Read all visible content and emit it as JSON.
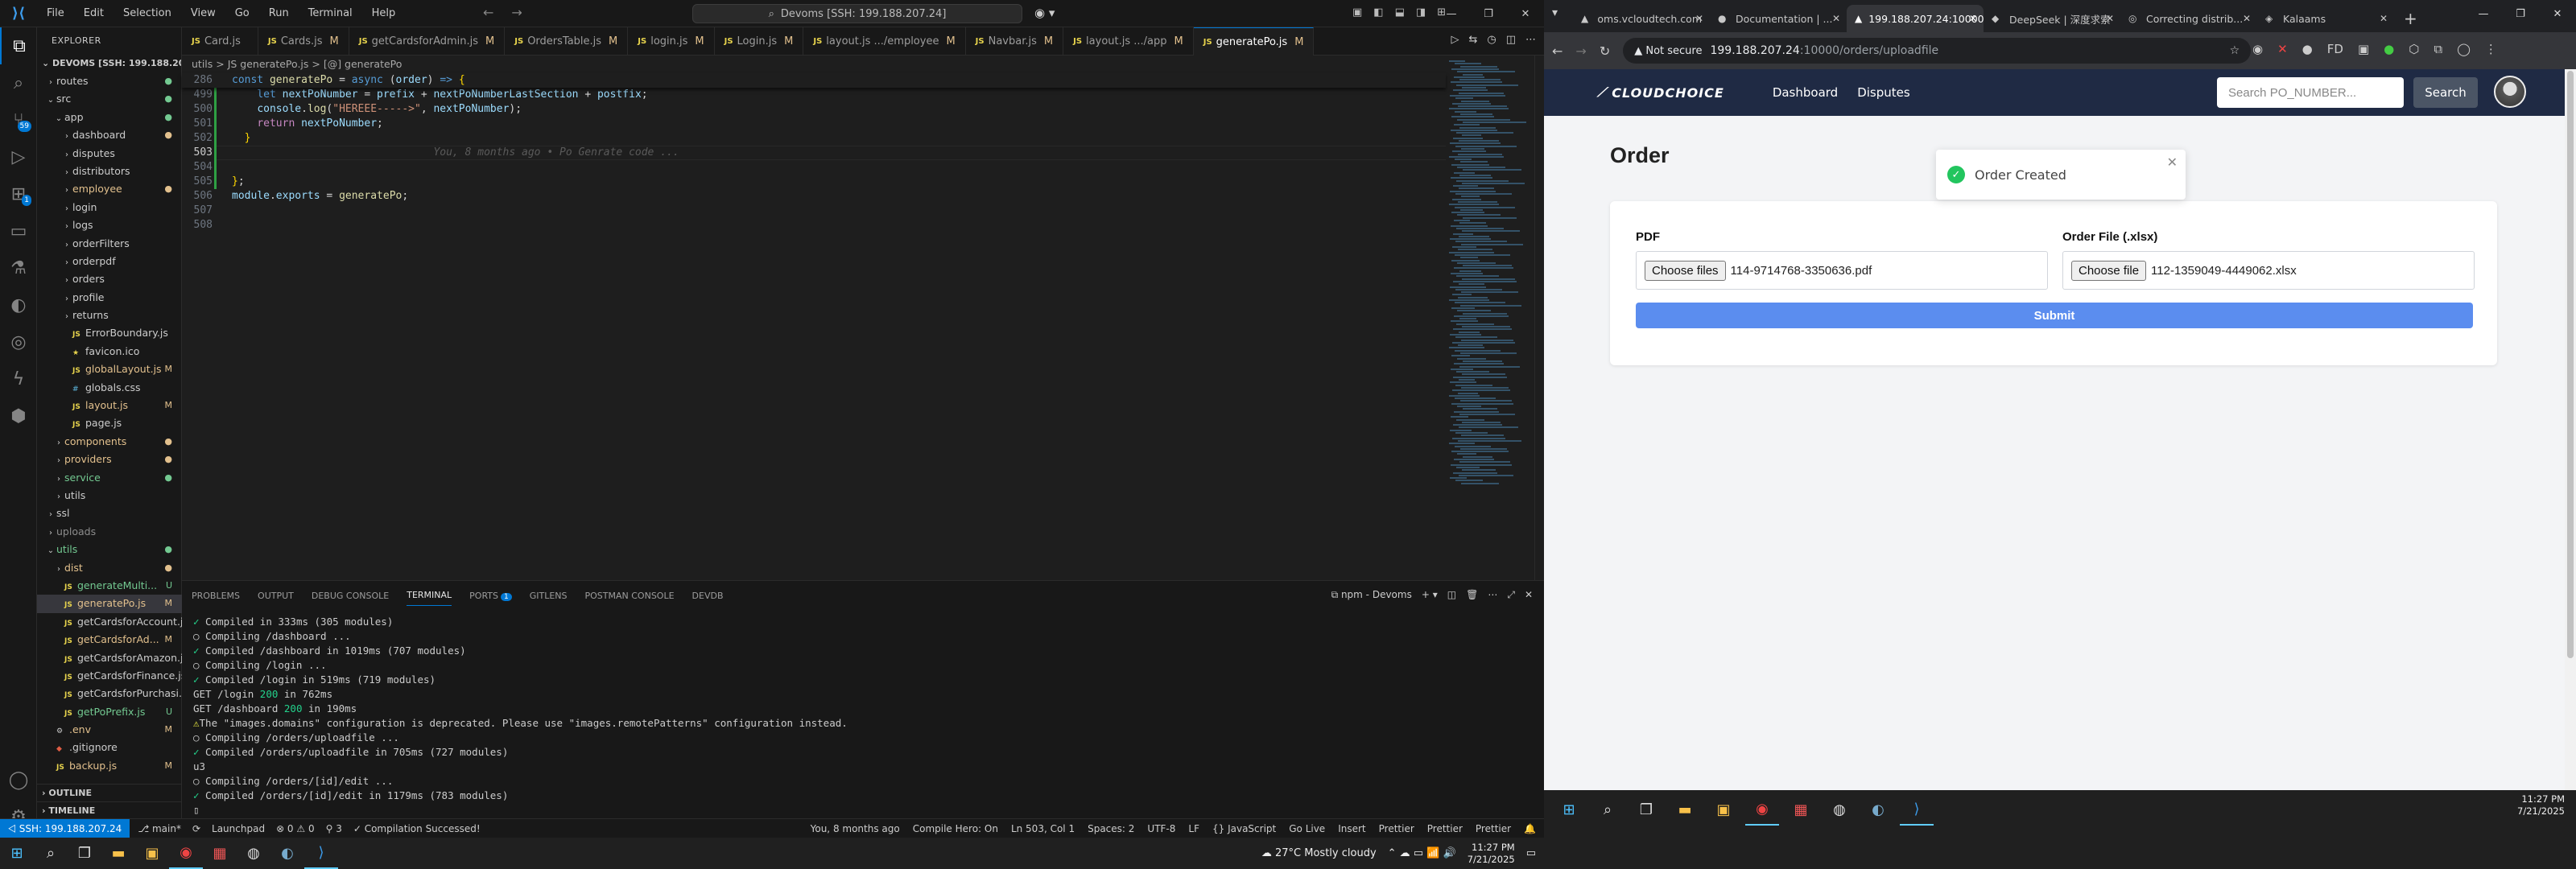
{
  "vscode": {
    "menu": [
      "File",
      "Edit",
      "Selection",
      "View",
      "Go",
      "Run",
      "Terminal",
      "Help"
    ],
    "command_center": "Devoms [SSH: 199.188.207.24]",
    "explorer": {
      "title": "EXPLORER",
      "root": "DEVOMS [SSH: 199.188.20...",
      "tree": [
        {
          "label": "routes",
          "indent": 1,
          "type": "folder",
          "open": false,
          "cls": "dot-g",
          "status": "●"
        },
        {
          "label": "src",
          "indent": 1,
          "type": "folder",
          "open": true,
          "cls": "dot-g",
          "status": "●"
        },
        {
          "label": "app",
          "indent": 2,
          "type": "folder",
          "open": true,
          "cls": "dot-g",
          "status": "●"
        },
        {
          "label": "dashboard",
          "indent": 3,
          "type": "folder",
          "open": false,
          "cls": "dot-y",
          "status": "●"
        },
        {
          "label": "disputes",
          "indent": 3,
          "type": "folder",
          "open": false,
          "cls": "",
          "status": ""
        },
        {
          "label": "distributors",
          "indent": 3,
          "type": "folder",
          "open": false,
          "cls": "",
          "status": ""
        },
        {
          "label": "employee",
          "indent": 3,
          "type": "folder",
          "open": false,
          "cls": "mod dot-y",
          "status": "●"
        },
        {
          "label": "login",
          "indent": 3,
          "type": "folder",
          "open": false,
          "cls": "",
          "status": ""
        },
        {
          "label": "logs",
          "indent": 3,
          "type": "folder",
          "open": false,
          "cls": "",
          "status": ""
        },
        {
          "label": "orderFilters",
          "indent": 3,
          "type": "folder",
          "open": false,
          "cls": "",
          "status": ""
        },
        {
          "label": "orderpdf",
          "indent": 3,
          "type": "folder",
          "open": false,
          "cls": "",
          "status": ""
        },
        {
          "label": "orders",
          "indent": 3,
          "type": "folder",
          "open": false,
          "cls": "",
          "status": ""
        },
        {
          "label": "profile",
          "indent": 3,
          "type": "folder",
          "open": false,
          "cls": "",
          "status": ""
        },
        {
          "label": "returns",
          "indent": 3,
          "type": "folder",
          "open": false,
          "cls": "",
          "status": ""
        },
        {
          "label": "ErrorBoundary.js",
          "indent": 3,
          "type": "js",
          "cls": "",
          "status": ""
        },
        {
          "label": "favicon.ico",
          "indent": 3,
          "type": "star",
          "cls": "",
          "status": ""
        },
        {
          "label": "globalLayout.js",
          "indent": 3,
          "type": "js",
          "cls": "mod",
          "status": "M"
        },
        {
          "label": "globals.css",
          "indent": 3,
          "type": "css",
          "cls": "",
          "status": ""
        },
        {
          "label": "layout.js",
          "indent": 3,
          "type": "js",
          "cls": "mod",
          "status": "M"
        },
        {
          "label": "page.js",
          "indent": 3,
          "type": "js",
          "cls": "",
          "status": ""
        },
        {
          "label": "components",
          "indent": 2,
          "type": "folder",
          "open": false,
          "cls": "mod dot-y",
          "status": "●"
        },
        {
          "label": "providers",
          "indent": 2,
          "type": "folder",
          "open": false,
          "cls": "mod dot-y",
          "status": "●"
        },
        {
          "label": "service",
          "indent": 2,
          "type": "folder",
          "open": false,
          "cls": "unt dot-g",
          "status": "●"
        },
        {
          "label": "utils",
          "indent": 2,
          "type": "folder",
          "open": false,
          "cls": "",
          "status": ""
        },
        {
          "label": "ssl",
          "indent": 1,
          "type": "folder",
          "open": false,
          "cls": "",
          "status": ""
        },
        {
          "label": "uploads",
          "indent": 1,
          "type": "folder",
          "open": false,
          "cls": "ign",
          "status": ""
        },
        {
          "label": "utils",
          "indent": 1,
          "type": "folder",
          "open": true,
          "cls": "unt dot-g",
          "status": "●"
        },
        {
          "label": "dist",
          "indent": 2,
          "type": "folder",
          "open": false,
          "cls": "mod dot-y",
          "status": "●"
        },
        {
          "label": "generateMulti...",
          "indent": 2,
          "type": "js",
          "cls": "unt",
          "status": "U"
        },
        {
          "label": "generatePo.js",
          "indent": 2,
          "type": "js",
          "cls": "mod sel",
          "status": "M"
        },
        {
          "label": "getCardsforAccount.js",
          "indent": 2,
          "type": "js",
          "cls": "",
          "status": ""
        },
        {
          "label": "getCardsforAd...",
          "indent": 2,
          "type": "js",
          "cls": "mod",
          "status": "M"
        },
        {
          "label": "getCardsforAmazon.js",
          "indent": 2,
          "type": "js",
          "cls": "",
          "status": ""
        },
        {
          "label": "getCardsforFinance.js",
          "indent": 2,
          "type": "js",
          "cls": "",
          "status": ""
        },
        {
          "label": "getCardsforPurchasi...",
          "indent": 2,
          "type": "js",
          "cls": "",
          "status": ""
        },
        {
          "label": "getPoPrefix.js",
          "indent": 2,
          "type": "js",
          "cls": "unt",
          "status": "U"
        },
        {
          "label": ".env",
          "indent": 1,
          "type": "gear",
          "cls": "mod",
          "status": "M"
        },
        {
          "label": ".gitignore",
          "indent": 1,
          "type": "git",
          "cls": "",
          "status": ""
        },
        {
          "label": "backup.js",
          "indent": 1,
          "type": "js",
          "cls": "mod",
          "status": "M"
        }
      ],
      "outline": "OUTLINE",
      "timeline": "TIMELINE"
    },
    "tabs": [
      {
        "label": "Card.js",
        "mod": ""
      },
      {
        "label": "Cards.js",
        "mod": "M"
      },
      {
        "label": "getCardsforAdmin.js",
        "mod": "M"
      },
      {
        "label": "OrdersTable.js",
        "mod": "M"
      },
      {
        "label": "login.js",
        "mod": "M"
      },
      {
        "label": "Login.js",
        "mod": "M"
      },
      {
        "label": "layout.js .../employee",
        "mod": "M"
      },
      {
        "label": "Navbar.js",
        "mod": "M"
      },
      {
        "label": "layout.js .../app",
        "mod": "M"
      },
      {
        "label": "generatePo.js",
        "mod": "M",
        "active": true
      }
    ],
    "breadcrumb": "utils > JS generatePo.js > [@] generatePo",
    "code": {
      "sticky_ln": "286",
      "lines": [
        {
          "ln": "499",
          "html": "    <span class=\"k\">let</span> <span class=\"v\">nextPoNumber</span> = <span class=\"v\">prefix</span> + <span class=\"v\">nextPoNumberLastSection</span> + <span class=\"v\">postfix</span>;"
        },
        {
          "ln": "500",
          "html": "    <span class=\"v\">console</span>.<span class=\"f\">log</span>(<span class=\"s\">\"HEREEE----->\"</span>, <span class=\"v\">nextPoNumber</span>);"
        },
        {
          "ln": "501",
          "html": "    <span class=\"p\">return</span> <span class=\"v\">nextPoNumber</span>;"
        },
        {
          "ln": "502",
          "html": "  <span class=\"bl\">}</span>"
        },
        {
          "ln": "503",
          "html": "                                <span class=\"gh\">You, 8 months ago • Po Genrate code ...</span>",
          "cur": true
        },
        {
          "ln": "504",
          "html": ""
        },
        {
          "ln": "505",
          "html": "<span class=\"bl\">}</span>;"
        },
        {
          "ln": "506",
          "html": "<span class=\"v\">module</span>.<span class=\"v\">exports</span> = <span class=\"f\">generatePo</span>;"
        },
        {
          "ln": "507",
          "html": ""
        },
        {
          "ln": "508",
          "html": ""
        }
      ],
      "sticky_html": "<span class=\"k\">const</span> <span class=\"f\">generatePo</span> = <span class=\"k\">async</span> (<span class=\"v\">order</span>) <span class=\"k\">=&gt;</span> <span class=\"bl\">{</span>"
    },
    "panel_tabs": [
      "PROBLEMS",
      "OUTPUT",
      "DEBUG CONSOLE",
      "TERMINAL",
      "PORTS",
      "GITLENS",
      "POSTMAN CONSOLE",
      "DEVDB"
    ],
    "ports_badge": "1",
    "terminal_name": "npm - Devoms",
    "terminal": [
      "<span class=\"ok\">✓</span> Compiled in 333ms (305 modules)",
      "○ Compiling /dashboard ...",
      "<span class=\"ok\">✓</span> Compiled /dashboard in 1019ms (707 modules)",
      "○ Compiling /login ...",
      "<span class=\"ok\">✓</span> Compiled /login in 519ms (719 modules)",
      "GET /login <span class=\"num\">200</span> in 762ms",
      "GET /dashboard <span class=\"num\">200</span> in 190ms",
      "<span class=\"warn\">⚠</span>The \"images.domains\" configuration is deprecated. Please use \"images.remotePatterns\" configuration instead.",
      "○ Compiling /orders/uploadfile ...",
      "<span class=\"ok\">✓</span> Compiled /orders/uploadfile in 705ms (727 modules)",
      "u3",
      "○ Compiling /orders/[id]/edit ...",
      "<span class=\"ok\">✓</span> Compiled /orders/[id]/edit in 1179ms (783 modules)",
      "▯"
    ],
    "status": {
      "remote": "⨞ SSH: 199.188.207.24",
      "branch": "⎇ main*",
      "sync": "⟳",
      "problems": "⊗ 0 ⚠ 0",
      "ports": "⚲ 3",
      "compile": "✓ Compilation Successed!",
      "launchpad": "Launchpad",
      "blame": "You, 8 months ago",
      "hero": "Compile Hero: On",
      "pos": "Ln 503, Col 1",
      "spaces": "Spaces: 2",
      "enc": "UTF-8",
      "eol": "LF",
      "lang": "{} JavaScript",
      "golive": "Go Live",
      "insert": "Insert",
      "prettier1": "Prettier",
      "prettier2": "Prettier",
      "prettier3": "Prettier"
    },
    "taskbar": {
      "weather": "27°C  Mostly cloudy",
      "time": "11:27 PM",
      "date": "7/21/2025"
    }
  },
  "chrome": {
    "tabs": [
      {
        "label": "oms.vcloudtech.com",
        "icon": "▲"
      },
      {
        "label": "Documentation | ...",
        "icon": "●"
      },
      {
        "label": "199.188.207.24:10000",
        "icon": "▲",
        "active": true
      },
      {
        "label": "DeepSeek | 深度求索",
        "icon": "◆"
      },
      {
        "label": "Correcting distrib...",
        "icon": "◎"
      },
      {
        "label": "Kalaams",
        "icon": "◈"
      }
    ],
    "not_secure": "Not secure",
    "url_host": "199.188.207.24",
    "url_path": ":10000/orders/uploadfile",
    "app": {
      "logo": "CLOUDCHOICE",
      "nav": [
        "Dashboard",
        "Disputes"
      ],
      "search_placeholder": "Search PO_NUMBER...",
      "search_btn": "Search",
      "toast": "Order Created",
      "title": "Order",
      "pdf_label": "PDF",
      "pdf_btn": "Choose files",
      "pdf_file": "114-9714768-3350636.pdf",
      "xlsx_label": "Order File (.xlsx)",
      "xlsx_btn": "Choose file",
      "xlsx_file": "112-1359049-4449062.xlsx",
      "submit": "Submit"
    },
    "taskbar": {
      "time": "11:27 PM",
      "date": "7/21/2025"
    }
  }
}
